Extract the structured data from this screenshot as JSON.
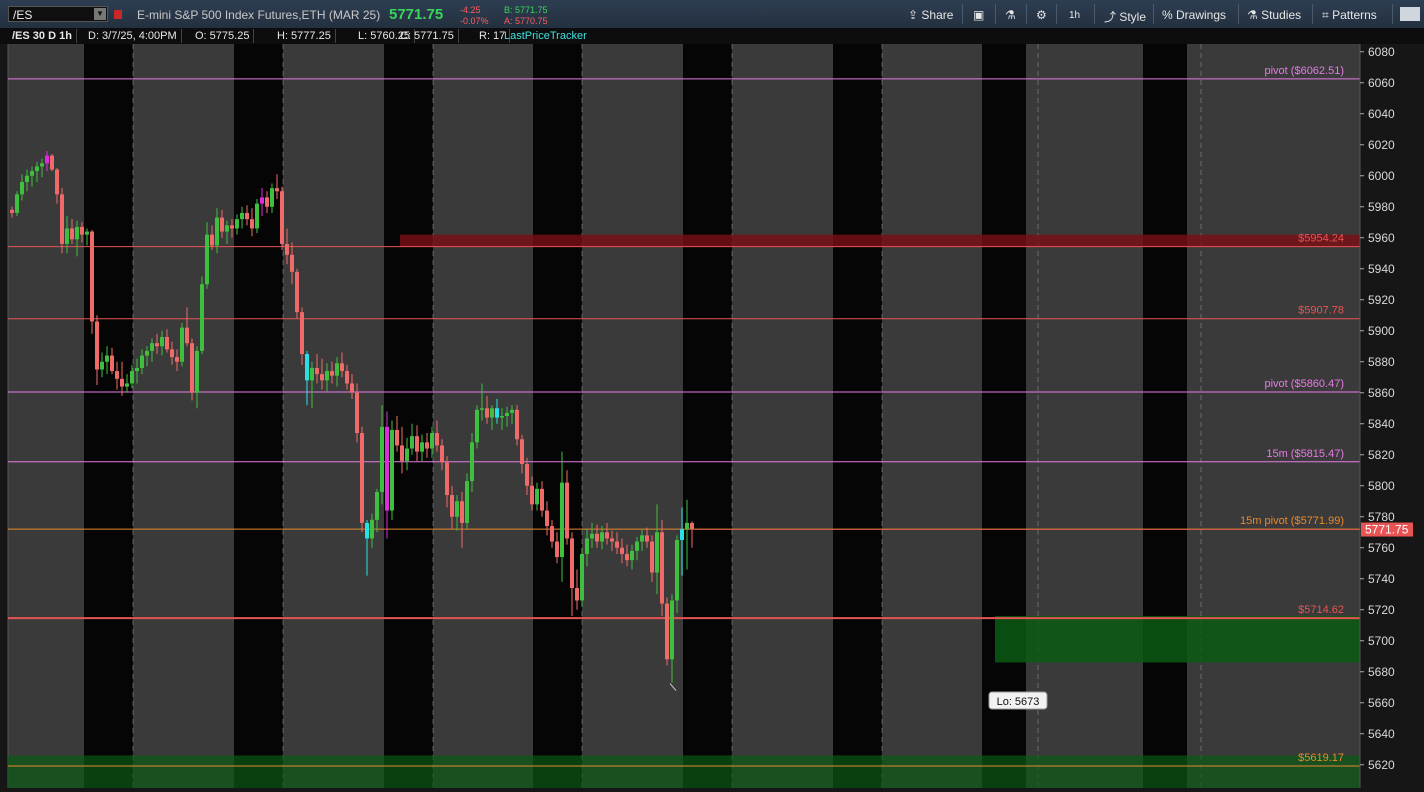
{
  "toolbar": {
    "symbol": "/ES",
    "instrument": "E-mini S&P 500 Index Futures,ETH (MAR 25)",
    "last": "5771.75",
    "change": "-4.25",
    "change_pct": "-0.07%",
    "bid": "B: 5771.75",
    "ask": "A: 5770.75",
    "share": "Share",
    "timeframe": "1h",
    "style": "Style",
    "drawings": "Drawings",
    "studies": "Studies",
    "patterns": "Patterns"
  },
  "header": {
    "symbol_tf": "/ES 30 D 1h",
    "date": "D: 3/7/25, 4:00PM",
    "open": "O: 5775.25",
    "high": "H: 5777.25",
    "low": "L: 5760.25",
    "close": "C: 5771.75",
    "range": "R: 17",
    "study": "LastPriceTracker"
  },
  "colors": {
    "up": "#3fbf3f",
    "down": "#f06a6a",
    "pivot": "#e57ce5",
    "level": "#e85454",
    "orange": "#e8892c",
    "zone_green": "#0c5a14",
    "zone_red": "#7a0f16"
  },
  "chart_data": {
    "type": "candlestick",
    "ylim": [
      5605,
      6085
    ],
    "y_ticks": [
      5620,
      5640,
      5660,
      5680,
      5700,
      5720,
      5740,
      5760,
      5780,
      5800,
      5820,
      5840,
      5860,
      5880,
      5900,
      5920,
      5940,
      5960,
      5980,
      6000,
      6020,
      6040,
      6060,
      6080
    ],
    "candles": [
      [
        5978,
        5980,
        5973,
        5976
      ],
      [
        5976,
        5990,
        5974,
        5988
      ],
      [
        5988,
        6001,
        5984,
        5996
      ],
      [
        5996,
        6004,
        5990,
        6000
      ],
      [
        6000,
        6006,
        5993,
        6003
      ],
      [
        6003,
        6009,
        5996,
        6006
      ],
      [
        6006,
        6011,
        5999,
        6008
      ],
      [
        6008,
        6016,
        6003,
        6013
      ],
      [
        6013,
        6014,
        6003,
        6004
      ],
      [
        6004,
        6005,
        5982,
        5988
      ],
      [
        5988,
        5992,
        5950,
        5956
      ],
      [
        5956,
        5974,
        5950,
        5966
      ],
      [
        5966,
        5972,
        5956,
        5959
      ],
      [
        5959,
        5971,
        5948,
        5967
      ],
      [
        5967,
        5970,
        5957,
        5962
      ],
      [
        5962,
        5966,
        5955,
        5964
      ],
      [
        5964,
        5965,
        5898,
        5906
      ],
      [
        5906,
        5910,
        5865,
        5875
      ],
      [
        5875,
        5886,
        5870,
        5880
      ],
      [
        5880,
        5890,
        5872,
        5884
      ],
      [
        5884,
        5889,
        5872,
        5874
      ],
      [
        5874,
        5880,
        5862,
        5869
      ],
      [
        5869,
        5880,
        5858,
        5864
      ],
      [
        5864,
        5872,
        5860,
        5866
      ],
      [
        5866,
        5878,
        5863,
        5874
      ],
      [
        5874,
        5882,
        5866,
        5876
      ],
      [
        5876,
        5888,
        5872,
        5884
      ],
      [
        5884,
        5890,
        5877,
        5887
      ],
      [
        5887,
        5895,
        5880,
        5892
      ],
      [
        5892,
        5898,
        5885,
        5890
      ],
      [
        5890,
        5900,
        5884,
        5896
      ],
      [
        5896,
        5901,
        5886,
        5888
      ],
      [
        5888,
        5893,
        5878,
        5883
      ],
      [
        5883,
        5888,
        5874,
        5880
      ],
      [
        5880,
        5905,
        5877,
        5902
      ],
      [
        5902,
        5915,
        5890,
        5892
      ],
      [
        5892,
        5895,
        5855,
        5860
      ],
      [
        5860,
        5890,
        5850,
        5887
      ],
      [
        5887,
        5935,
        5885,
        5930
      ],
      [
        5930,
        5970,
        5927,
        5962
      ],
      [
        5962,
        5968,
        5952,
        5955
      ],
      [
        5955,
        5979,
        5950,
        5973
      ],
      [
        5973,
        5978,
        5960,
        5964
      ],
      [
        5964,
        5971,
        5956,
        5968
      ],
      [
        5968,
        5972,
        5960,
        5966
      ],
      [
        5966,
        5975,
        5962,
        5972
      ],
      [
        5972,
        5980,
        5966,
        5976
      ],
      [
        5976,
        5981,
        5968,
        5972
      ],
      [
        5972,
        5979,
        5961,
        5966
      ],
      [
        5966,
        5985,
        5963,
        5982
      ],
      [
        5982,
        5992,
        5974,
        5986
      ],
      [
        5986,
        5990,
        5976,
        5980
      ],
      [
        5980,
        5995,
        5976,
        5992
      ],
      [
        5992,
        6001,
        5985,
        5990
      ],
      [
        5990,
        5993,
        5952,
        5956
      ],
      [
        5956,
        5966,
        5943,
        5949
      ],
      [
        5949,
        5957,
        5930,
        5938
      ],
      [
        5938,
        5940,
        5908,
        5912
      ],
      [
        5912,
        5915,
        5878,
        5885
      ],
      [
        5885,
        5887,
        5852,
        5868
      ],
      [
        5868,
        5880,
        5850,
        5876
      ],
      [
        5876,
        5885,
        5866,
        5872
      ],
      [
        5872,
        5882,
        5862,
        5868
      ],
      [
        5868,
        5879,
        5861,
        5874
      ],
      [
        5874,
        5880,
        5866,
        5871
      ],
      [
        5871,
        5883,
        5864,
        5879
      ],
      [
        5879,
        5886,
        5870,
        5874
      ],
      [
        5874,
        5878,
        5862,
        5866
      ],
      [
        5866,
        5872,
        5856,
        5860
      ],
      [
        5860,
        5866,
        5828,
        5834
      ],
      [
        5834,
        5838,
        5770,
        5776
      ],
      [
        5776,
        5778,
        5742,
        5766
      ],
      [
        5766,
        5782,
        5760,
        5778
      ],
      [
        5778,
        5798,
        5770,
        5796
      ],
      [
        5796,
        5852,
        5788,
        5838
      ],
      [
        5838,
        5848,
        5766,
        5784
      ],
      [
        5784,
        5842,
        5778,
        5836
      ],
      [
        5836,
        5845,
        5822,
        5826
      ],
      [
        5826,
        5838,
        5808,
        5816
      ],
      [
        5816,
        5831,
        5810,
        5824
      ],
      [
        5824,
        5840,
        5820,
        5832
      ],
      [
        5832,
        5839,
        5816,
        5822
      ],
      [
        5822,
        5833,
        5816,
        5828
      ],
      [
        5828,
        5834,
        5818,
        5824
      ],
      [
        5824,
        5838,
        5818,
        5834
      ],
      [
        5834,
        5842,
        5822,
        5826
      ],
      [
        5826,
        5830,
        5810,
        5815
      ],
      [
        5815,
        5819,
        5786,
        5794
      ],
      [
        5794,
        5800,
        5772,
        5780
      ],
      [
        5780,
        5794,
        5771,
        5790
      ],
      [
        5790,
        5796,
        5760,
        5776
      ],
      [
        5776,
        5808,
        5772,
        5803
      ],
      [
        5803,
        5834,
        5796,
        5828
      ],
      [
        5828,
        5852,
        5824,
        5849
      ],
      [
        5849,
        5866,
        5842,
        5850
      ],
      [
        5850,
        5858,
        5840,
        5844
      ],
      [
        5844,
        5852,
        5836,
        5850
      ],
      [
        5850,
        5856,
        5840,
        5844
      ],
      [
        5844,
        5850,
        5836,
        5845
      ],
      [
        5845,
        5851,
        5838,
        5847
      ],
      [
        5847,
        5852,
        5840,
        5849
      ],
      [
        5849,
        5852,
        5826,
        5830
      ],
      [
        5830,
        5833,
        5808,
        5814
      ],
      [
        5814,
        5818,
        5794,
        5800
      ],
      [
        5800,
        5806,
        5784,
        5788
      ],
      [
        5788,
        5802,
        5784,
        5798
      ],
      [
        5798,
        5803,
        5780,
        5784
      ],
      [
        5784,
        5790,
        5768,
        5774
      ],
      [
        5774,
        5778,
        5760,
        5764
      ],
      [
        5764,
        5770,
        5750,
        5754
      ],
      [
        5754,
        5822,
        5738,
        5802
      ],
      [
        5802,
        5810,
        5762,
        5766
      ],
      [
        5766,
        5770,
        5716,
        5734
      ],
      [
        5734,
        5746,
        5720,
        5726
      ],
      [
        5726,
        5760,
        5722,
        5756
      ],
      [
        5756,
        5772,
        5748,
        5766
      ],
      [
        5766,
        5776,
        5760,
        5769
      ],
      [
        5769,
        5775,
        5760,
        5764
      ],
      [
        5764,
        5774,
        5759,
        5770
      ],
      [
        5770,
        5776,
        5762,
        5766
      ],
      [
        5766,
        5771,
        5758,
        5764
      ],
      [
        5764,
        5770,
        5756,
        5760
      ],
      [
        5760,
        5766,
        5750,
        5756
      ],
      [
        5756,
        5762,
        5748,
        5752
      ],
      [
        5752,
        5762,
        5746,
        5758
      ],
      [
        5758,
        5767,
        5752,
        5764
      ],
      [
        5764,
        5772,
        5758,
        5768
      ],
      [
        5768,
        5773,
        5760,
        5764
      ],
      [
        5764,
        5768,
        5738,
        5744
      ],
      [
        5744,
        5788,
        5730,
        5770
      ],
      [
        5770,
        5778,
        5716,
        5724
      ],
      [
        5724,
        5728,
        5684,
        5688
      ],
      [
        5688,
        5730,
        5673,
        5726
      ],
      [
        5726,
        5768,
        5718,
        5765
      ],
      [
        5765,
        5786,
        5742,
        5772
      ],
      [
        5772,
        5791,
        5746,
        5776
      ],
      [
        5776,
        5777,
        5760,
        5772
      ]
    ],
    "special_candles": [
      {
        "index": 7,
        "color": "magenta"
      },
      {
        "index": 50,
        "color": "magenta"
      },
      {
        "index": 59,
        "color": "cyan"
      },
      {
        "index": 71,
        "color": "cyan"
      },
      {
        "index": 75,
        "color": "magenta"
      },
      {
        "index": 97,
        "color": "cyan"
      },
      {
        "index": 134,
        "color": "cyan"
      }
    ],
    "levels": [
      {
        "price": 6062.51,
        "label": "pivot ($6062.51)",
        "color": "#e57ce5"
      },
      {
        "price": 5954.24,
        "label": "$5954.24",
        "color": "#e85454"
      },
      {
        "price": 5907.78,
        "label": "$5907.78",
        "color": "#e85454"
      },
      {
        "price": 5860.47,
        "label": "pivot ($5860.47)",
        "color": "#e57ce5"
      },
      {
        "price": 5815.47,
        "label": "15m  ($5815.47)",
        "color": "#e57ce5"
      },
      {
        "price": 5771.99,
        "label": "15m pivot ($5771.99)",
        "color": "#e8892c"
      },
      {
        "price": 5714.62,
        "label": "$5714.62",
        "color": "#e85454"
      },
      {
        "price": 5619.17,
        "label": "$5619.17",
        "color": "#e8892c"
      }
    ],
    "zones": [
      {
        "from": 5954,
        "to": 5962,
        "color": "red"
      },
      {
        "from": 5686,
        "to": 5716,
        "color": "green"
      },
      {
        "from": 5605,
        "to": 5626,
        "color": "green"
      }
    ],
    "last_price_tag": "5771.75",
    "low_label": "Lo: 5673",
    "low_price": 5673
  }
}
